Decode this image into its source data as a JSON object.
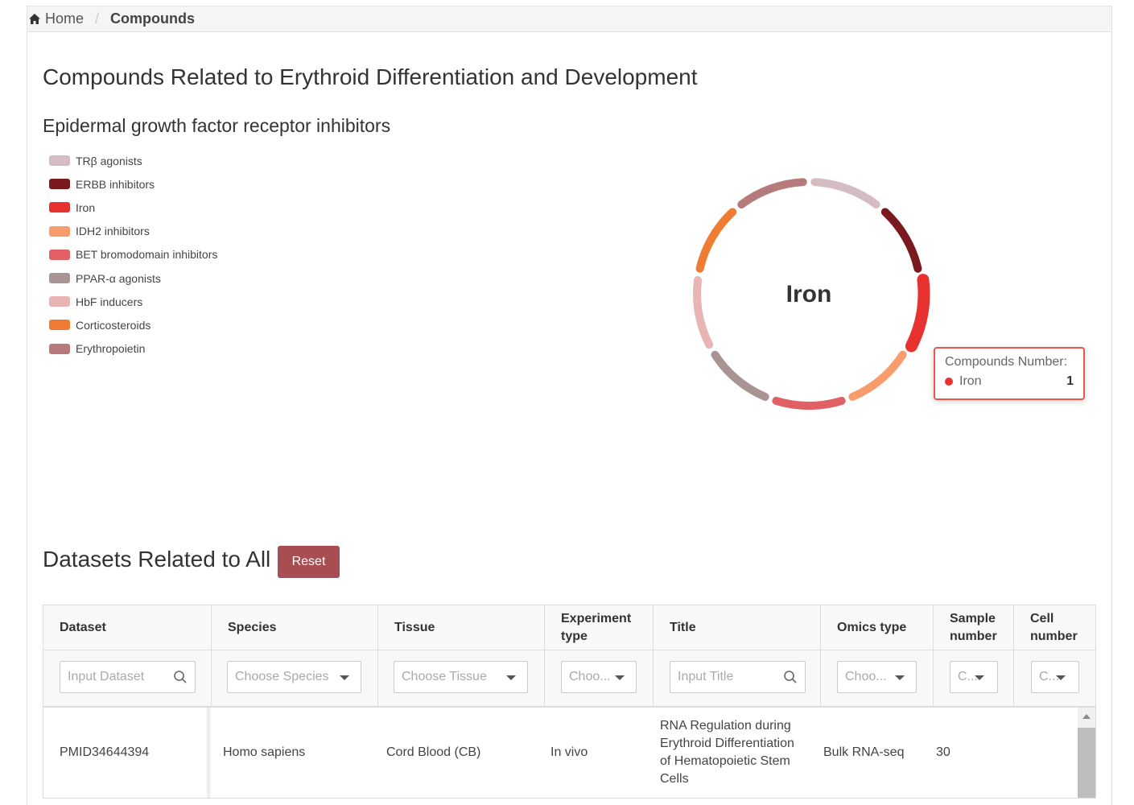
{
  "breadcrumb": {
    "home": "Home",
    "separator": "/",
    "current": "Compounds"
  },
  "page_title": "Compounds Related to Erythroid Differentiation and Development",
  "chart_data": {
    "type": "pie",
    "variant": "donut",
    "title": "Epidermal growth factor receptor inhibitors",
    "center_label": "Iron",
    "legend_placement": "left",
    "categories": [
      "TRβ agonists",
      "ERBB inhibitors",
      "Iron",
      "IDH2 inhibitors",
      "BET bromodomain inhibitors",
      "PPAR-α agonists",
      "HbF inducers",
      "Corticosteroids",
      "Erythropoietin"
    ],
    "values": [
      1,
      1,
      1,
      1,
      1,
      1,
      1,
      1,
      1
    ],
    "colors": [
      "#d4bcc2",
      "#7a1a1f",
      "#e8322f",
      "#f99c6b",
      "#e06065",
      "#a89593",
      "#e8b4b4",
      "#ee7d33",
      "#b67a7c"
    ],
    "highlighted": "Iron",
    "tooltip": {
      "title": "Compounds Number:",
      "label": "Iron",
      "value": "1"
    }
  },
  "datasets": {
    "title": "Datasets Related to All",
    "reset_label": "Reset",
    "columns": [
      "Dataset",
      "Species",
      "Tissue",
      "Experiment type",
      "Title",
      "Omics type",
      "Sample number",
      "Cell number"
    ],
    "filters": {
      "dataset": "Input Dataset",
      "species": "Choose Species",
      "tissue": "Choose Tissue",
      "experiment": "Choo...",
      "title": "Input Title",
      "omics": "Choo...",
      "sample": "C...",
      "cell": "C..."
    },
    "rows": [
      [
        "PMID34644394",
        "Homo sapiens",
        "Cord Blood (CB)",
        "In vivo",
        "RNA Regulation during Erythroid Differentiation of Hematopoietic Stem Cells",
        "Bulk RNA-seq",
        "30",
        ""
      ]
    ]
  },
  "icons": {
    "home": "home-icon",
    "search": "search-icon",
    "dropdown": "caret-down-icon"
  }
}
